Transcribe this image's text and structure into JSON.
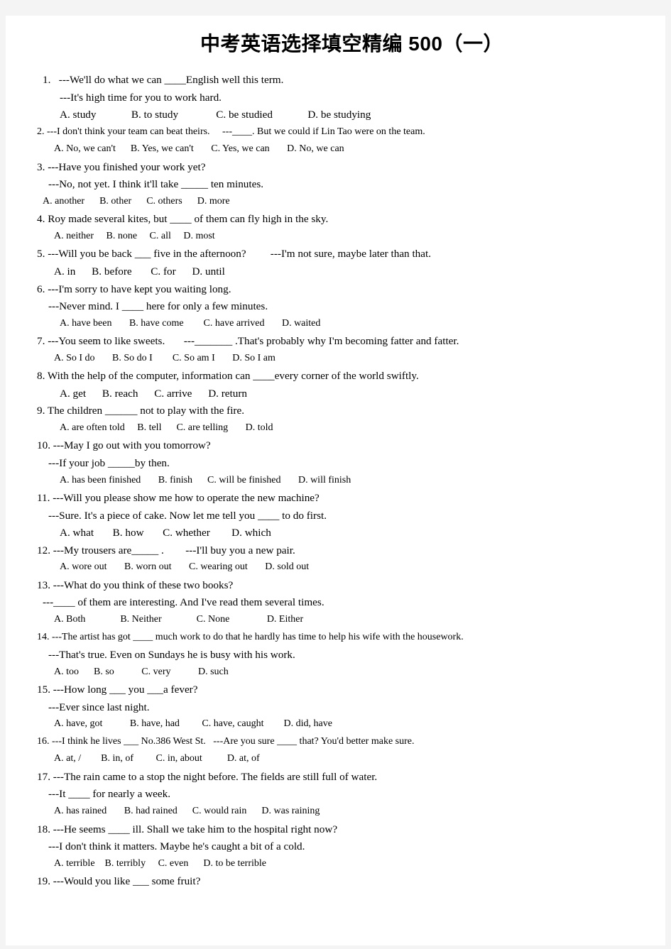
{
  "document": {
    "title": "中考英语选择填空精编 500（一）",
    "page_background": "#ffffff",
    "outer_background": "#f4f4f4",
    "text_color": "#000000"
  },
  "lines": [
    {
      "text": "1.   ---We'll do what we can ____English well this term.",
      "indent": 1,
      "size": "md"
    },
    {
      "text": "---It's high time for you to work hard.",
      "indent": 4,
      "size": "md"
    },
    {
      "text": "A. study             B. to study              C. be studied             D. be studying",
      "indent": 4,
      "size": "md"
    },
    {
      "text": "2. ---I don't think your team can beat theirs.     ---____. But we could if Lin Tao were on the team.",
      "indent": 0,
      "size": "sm"
    },
    {
      "text": "A. No, we can't      B. Yes, we can't       C. Yes, we can       D. No, we can",
      "indent": 3,
      "size": "sm"
    },
    {
      "text": "3. ---Have you finished your work yet?",
      "indent": 0,
      "size": "md"
    },
    {
      "text": "---No, not yet. I think it'll take _____ ten minutes.",
      "indent": 2,
      "size": "md"
    },
    {
      "text": "A. another      B. other      C. others      D. more",
      "indent": 1,
      "size": "sm"
    },
    {
      "text": "4. Roy made several kites, but ____ of them can fly high in the sky.",
      "indent": 0,
      "size": "md"
    },
    {
      "text": "A. neither     B. none     C. all     D. most",
      "indent": 3,
      "size": "sm"
    },
    {
      "text": "5. ---Will you be back ___ five in the afternoon?         ---I'm not sure, maybe later than that.",
      "indent": 0,
      "size": "md"
    },
    {
      "text": "A. in      B. before       C. for      D. until",
      "indent": 3,
      "size": "md"
    },
    {
      "text": "6. ---I'm sorry to have kept you waiting long.",
      "indent": 0,
      "size": "md"
    },
    {
      "text": "---Never mind. I ____ here for only a few minutes.",
      "indent": 2,
      "size": "md"
    },
    {
      "text": "A. have been       B. have come        C. have arrived       D. waited",
      "indent": 4,
      "size": "sm"
    },
    {
      "text": "7. ---You seem to like sweets.       ---_______ .That's probably why I'm becoming fatter and fatter.",
      "indent": 0,
      "size": "md"
    },
    {
      "text": "A. So I do       B. So do I        C. So am I       D. So I am",
      "indent": 3,
      "size": "sm"
    },
    {
      "text": "8. With the help of the computer, information can ____every corner of the world swiftly.",
      "indent": 0,
      "size": "md"
    },
    {
      "text": "A. get      B. reach      C. arrive      D. return",
      "indent": 4,
      "size": "md"
    },
    {
      "text": "9. The children ______ not to play with the fire.",
      "indent": 0,
      "size": "md"
    },
    {
      "text": "A. are often told     B. tell      C. are telling       D. told",
      "indent": 4,
      "size": "sm"
    },
    {
      "text": "10. ---May I go out with you tomorrow?",
      "indent": 0,
      "size": "md"
    },
    {
      "text": "---If your job _____by then.",
      "indent": 2,
      "size": "md"
    },
    {
      "text": "A. has been finished       B. finish      C. will be finished       D. will finish",
      "indent": 4,
      "size": "sm"
    },
    {
      "text": "11. ---Will you please show me how to operate the new machine?",
      "indent": 0,
      "size": "md"
    },
    {
      "text": "---Sure. It's a piece of cake. Now let me tell you ____ to do first.",
      "indent": 2,
      "size": "md"
    },
    {
      "text": "A. what       B. how       C. whether        D. which",
      "indent": 4,
      "size": "md"
    },
    {
      "text": "12. ---My trousers are_____ .        ---I'll buy you a new pair.",
      "indent": 0,
      "size": "md"
    },
    {
      "text": "A. wore out       B. worn out       C. wearing out       D. sold out",
      "indent": 4,
      "size": "sm"
    },
    {
      "text": "13. ---What do you think of these two books?",
      "indent": 0,
      "size": "md"
    },
    {
      "text": "---____ of them are interesting. And I've read them several times.",
      "indent": 1,
      "size": "md"
    },
    {
      "text": "A. Both              B. Neither              C. None               D. Either",
      "indent": 3,
      "size": "sm"
    },
    {
      "text": "14. ---The artist has got ____ much work to do that he hardly has time to help his wife with the housework.",
      "indent": 0,
      "size": "sm"
    },
    {
      "text": "---That's true. Even on Sundays he is busy with his work.",
      "indent": 2,
      "size": "md"
    },
    {
      "text": "A. too      B. so           C. very           D. such",
      "indent": 3,
      "size": "sm"
    },
    {
      "text": "15. ---How long ___ you ___a fever?",
      "indent": 0,
      "size": "md"
    },
    {
      "text": "---Ever since last night.",
      "indent": 2,
      "size": "md"
    },
    {
      "text": "A. have, got           B. have, had         C. have, caught        D. did, have",
      "indent": 3,
      "size": "sm"
    },
    {
      "text": "16. ---I think he lives ___ No.386 West St.   ---Are you sure ____ that? You'd better make sure.",
      "indent": 0,
      "size": "sm"
    },
    {
      "text": "A. at, /        B. in, of         C. in, about          D. at, of",
      "indent": 3,
      "size": "sm"
    },
    {
      "text": "17. ---The rain came to a stop the night before. The fields are still full of water.",
      "indent": 0,
      "size": "md"
    },
    {
      "text": "---It ____ for nearly a week.",
      "indent": 2,
      "size": "md"
    },
    {
      "text": "A. has rained       B. had rained      C. would rain      D. was raining",
      "indent": 3,
      "size": "sm"
    },
    {
      "text": "18. ---He seems ____ ill. Shall we take him to the hospital right now?",
      "indent": 0,
      "size": "md"
    },
    {
      "text": "---I don't think it matters. Maybe he's caught a bit of a cold.",
      "indent": 2,
      "size": "md"
    },
    {
      "text": "A. terrible    B. terribly     C. even      D. to be terrible",
      "indent": 3,
      "size": "sm"
    },
    {
      "text": "19. ---Would you like ___ some fruit?",
      "indent": 0,
      "size": "md"
    }
  ]
}
